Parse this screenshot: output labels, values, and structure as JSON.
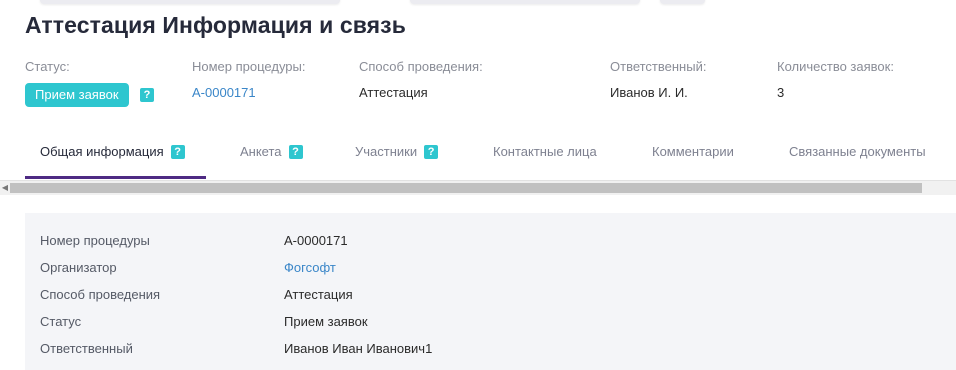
{
  "title": "Аттестация Информация и связь",
  "meta": {
    "status_label": "Статус:",
    "status_value": "Прием заявок",
    "number_label": "Номер процедуры:",
    "number_value": "A-0000171",
    "method_label": "Способ проведения:",
    "method_value": "Аттестация",
    "responsible_label": "Ответственный:",
    "responsible_value": "Иванов И. И.",
    "count_label": "Количество заявок:",
    "count_value": "3"
  },
  "help_glyph": "?",
  "tabs": [
    {
      "label": "Общая информация",
      "active": true,
      "help": true
    },
    {
      "label": "Анкета",
      "active": false,
      "help": true
    },
    {
      "label": "Участники",
      "active": false,
      "help": true
    },
    {
      "label": "Контактные лица",
      "active": false,
      "help": false
    },
    {
      "label": "Комментарии",
      "active": false,
      "help": false
    },
    {
      "label": "Связанные документы",
      "active": false,
      "help": false
    }
  ],
  "info": {
    "rows": [
      {
        "label": "Номер процедуры",
        "value": "A-0000171"
      },
      {
        "label": "Организатор",
        "value": "Фогсофт"
      },
      {
        "label": "Способ проведения",
        "value": "Аттестация"
      },
      {
        "label": "Статус",
        "value": "Прием заявок"
      },
      {
        "label": "Ответственный",
        "value": "Иванов Иван Иванович1"
      }
    ]
  },
  "colors": {
    "accent": "#2ec6cf",
    "tab_underline": "#4e2a83",
    "link": "#3a86c8"
  },
  "icons": {
    "help": "help-icon",
    "scroll_left": "chevron-left-icon"
  }
}
